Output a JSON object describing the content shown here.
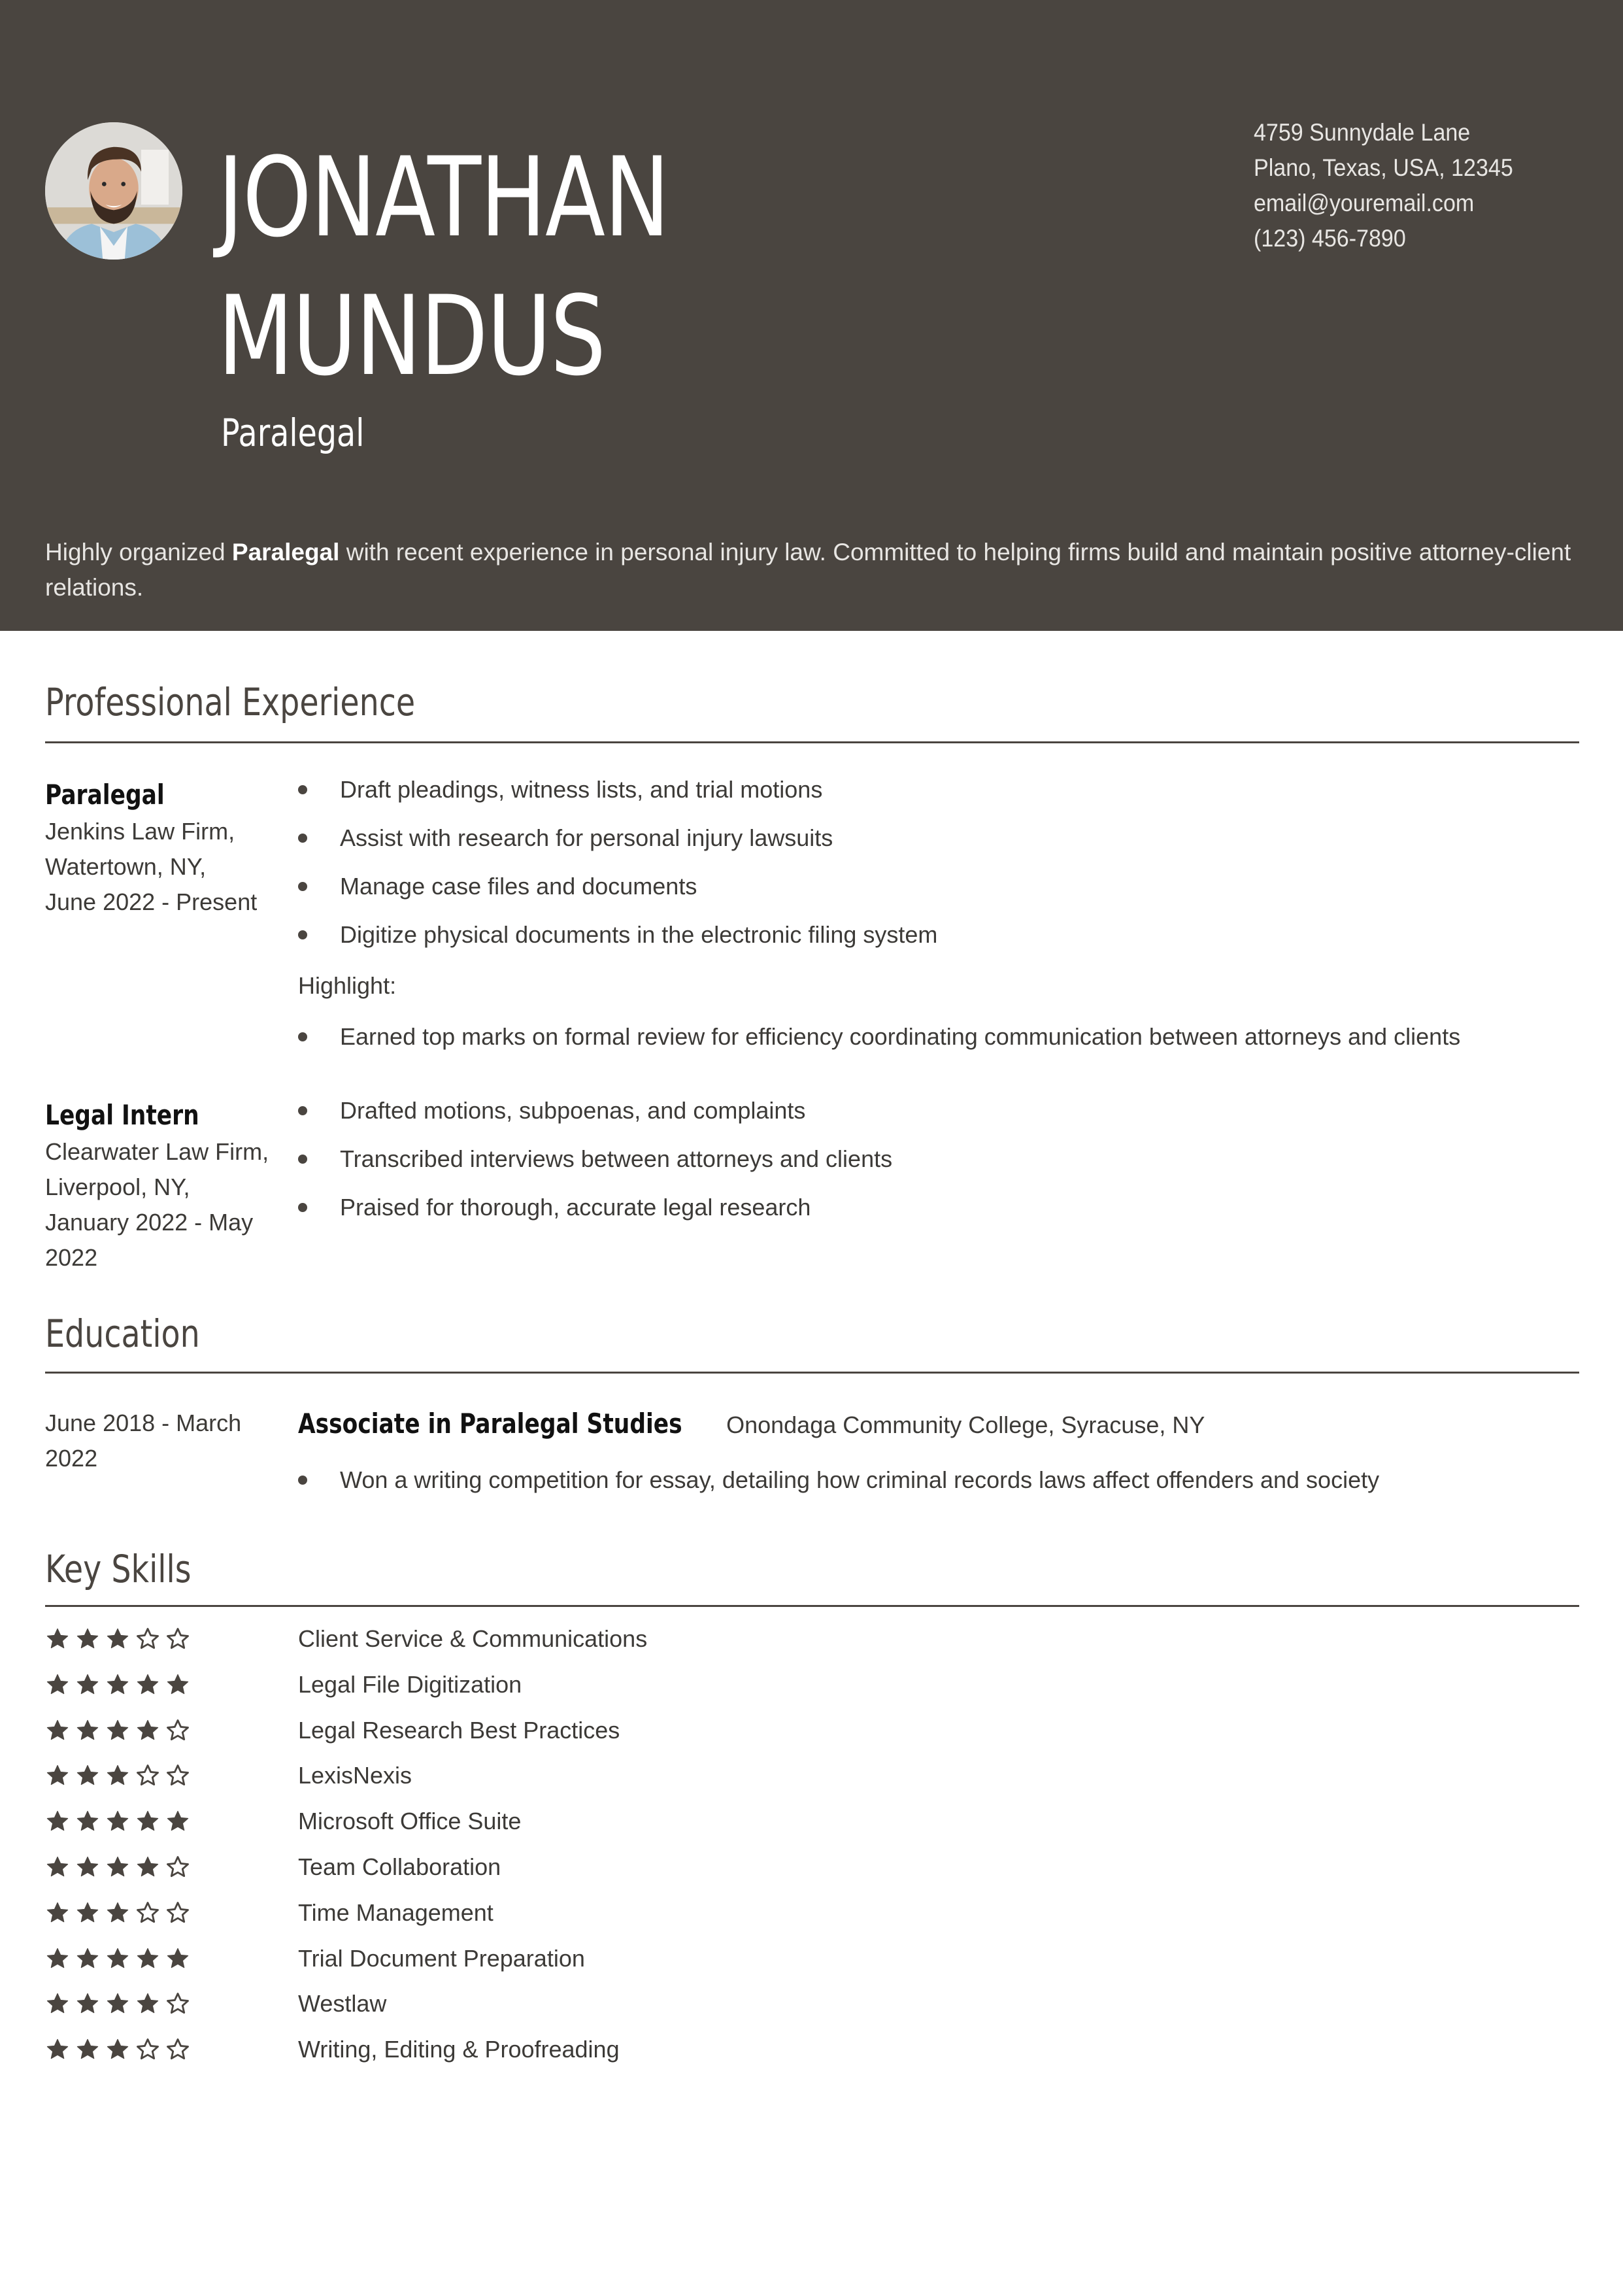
{
  "header": {
    "name_line1": "JONATHAN",
    "name_line2": "MUNDUS",
    "job_title": "Paralegal",
    "photo_alt": "profile-photo",
    "contact": {
      "address_line1": "4759 Sunnydale Lane",
      "address_line2": "Plano, Texas, USA, 12345",
      "email": "email@youremail.com",
      "phone": "(123) 456-7890"
    },
    "summary": {
      "prefix": "Highly organized ",
      "bold": "Paralegal",
      "suffix": " with recent experience in personal injury law. Committed to helping firms build and maintain positive attorney-client relations."
    }
  },
  "experience": {
    "title": "Professional Experience",
    "jobs": [
      {
        "role": "Paralegal",
        "employer": "Jenkins Law Firm,",
        "location": "Watertown, NY,",
        "dates": "June 2022 - Present",
        "bullets": [
          "Draft pleadings, witness lists, and trial motions",
          "Assist with research for personal injury lawsuits",
          "Manage case files and documents",
          "Digitize physical documents in the electronic filing system"
        ],
        "highlight_label": "Highlight:",
        "highlights": [
          "Earned top marks on formal review for efficiency coordinating communication between attorneys and clients"
        ]
      },
      {
        "role": "Legal Intern",
        "employer": "Clearwater Law Firm,",
        "location": "Liverpool, NY,",
        "dates_line1": "January 2022 - May",
        "dates_line2": "2022",
        "bullets": [
          "Drafted motions, subpoenas, and complaints",
          "Transcribed interviews between attorneys and clients",
          "Praised for thorough, accurate legal research"
        ]
      }
    ]
  },
  "education": {
    "title": "Education",
    "entries": [
      {
        "dates_line1": "June 2018 - March",
        "dates_line2": "2022",
        "degree": "Associate in Paralegal Studies",
        "school": "Onondaga Community College, Syracuse, NY",
        "bullets": [
          "Won a writing competition for essay, detailing how criminal records laws affect offenders and society"
        ]
      }
    ]
  },
  "skills": {
    "title": "Key Skills",
    "max_rating": 5,
    "items": [
      {
        "name": "Client Service & Communications",
        "rating": 3
      },
      {
        "name": "Legal File Digitization",
        "rating": 5
      },
      {
        "name": "Legal Research Best Practices",
        "rating": 4
      },
      {
        "name": "LexisNexis",
        "rating": 3
      },
      {
        "name": "Microsoft Office Suite",
        "rating": 5
      },
      {
        "name": "Team Collaboration",
        "rating": 4
      },
      {
        "name": "Time Management",
        "rating": 3
      },
      {
        "name": "Trial Document Preparation",
        "rating": 5
      },
      {
        "name": "Westlaw",
        "rating": 4
      },
      {
        "name": "Writing, Editing & Proofreading",
        "rating": 3
      }
    ]
  },
  "colors": {
    "header_bg": "#4a4540",
    "accent": "#4a4540",
    "header_text": "#ffffff",
    "body_text": "#3c3a37"
  }
}
